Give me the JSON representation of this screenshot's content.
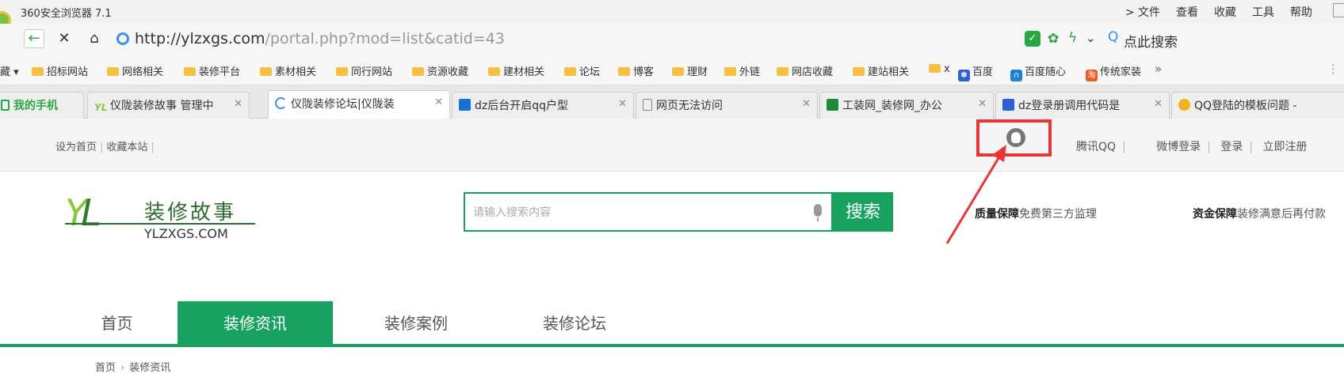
{
  "browser": {
    "title": "360安全浏览器 7.1",
    "menu": [
      "> 文件",
      "查看",
      "收藏",
      "工具",
      "帮助"
    ],
    "url_domain": "http://ylzxgs.com",
    "url_path": "/portal.php?mod=list&catid=43",
    "search_placeholder": "点此搜索",
    "bookmarks_lead": "藏 ▾",
    "bookmarks": [
      {
        "label": "招标网站",
        "icon": "folder"
      },
      {
        "label": "网络相关",
        "icon": "folder"
      },
      {
        "label": "装修平台",
        "icon": "folder"
      },
      {
        "label": "素材相关",
        "icon": "folder"
      },
      {
        "label": "同行网站",
        "icon": "folder"
      },
      {
        "label": "资源收藏",
        "icon": "folder"
      },
      {
        "label": "建材相关",
        "icon": "folder"
      },
      {
        "label": "论坛",
        "icon": "folder"
      },
      {
        "label": "博客",
        "icon": "folder"
      },
      {
        "label": "理财",
        "icon": "folder"
      },
      {
        "label": "外链",
        "icon": "folder"
      },
      {
        "label": "网店收藏",
        "icon": "folder"
      },
      {
        "label": "建站相关",
        "icon": "folder"
      },
      {
        "label": "x",
        "icon": "folder"
      },
      {
        "label": "百度",
        "icon": "baidu"
      },
      {
        "label": "百度随心",
        "icon": "baidu-suixin"
      },
      {
        "label": "传统家装",
        "icon": "taobao"
      }
    ],
    "bookmarks_more": "»",
    "tabs": [
      {
        "label": "我的手机",
        "icon": "phone"
      },
      {
        "label": "仪陇装修故事 管理中",
        "icon": "yl-logo"
      },
      {
        "label": "仪陇装修论坛|仪陇装",
        "icon": "loading",
        "active": true
      },
      {
        "label": "dz后台开启qq户型",
        "icon": "dz"
      },
      {
        "label": "网页无法访问",
        "icon": "page"
      },
      {
        "label": "工装网_装修网_办公",
        "icon": "gz"
      },
      {
        "label": "dz登录册调用代码是",
        "icon": "baidu"
      },
      {
        "label": "QQ登陆的模板问题 -",
        "icon": "qq-yellow"
      }
    ]
  },
  "site": {
    "top_left": [
      "设为首页",
      "收藏本站"
    ],
    "top_right": [
      "腾讯QQ",
      "微博登录",
      "登录",
      "立即注册"
    ],
    "logo_cn": "装修故事",
    "logo_en": "YLZXGS.COM",
    "search_placeholder": "请输入搜索内容",
    "search_button": "搜索",
    "promos": [
      {
        "bold": "质量保障",
        "text": "免费第三方监理"
      },
      {
        "bold": "资金保障",
        "text": "装修满意后再付款"
      }
    ],
    "nav": [
      {
        "label": "首页"
      },
      {
        "label": "装修资讯",
        "active": true
      },
      {
        "label": "装修案例"
      },
      {
        "label": "装修论坛"
      }
    ],
    "breadcrumb": [
      "首页",
      "装修资讯"
    ]
  },
  "colors": {
    "accent": "#19a15f",
    "highlight": "#e83535"
  }
}
